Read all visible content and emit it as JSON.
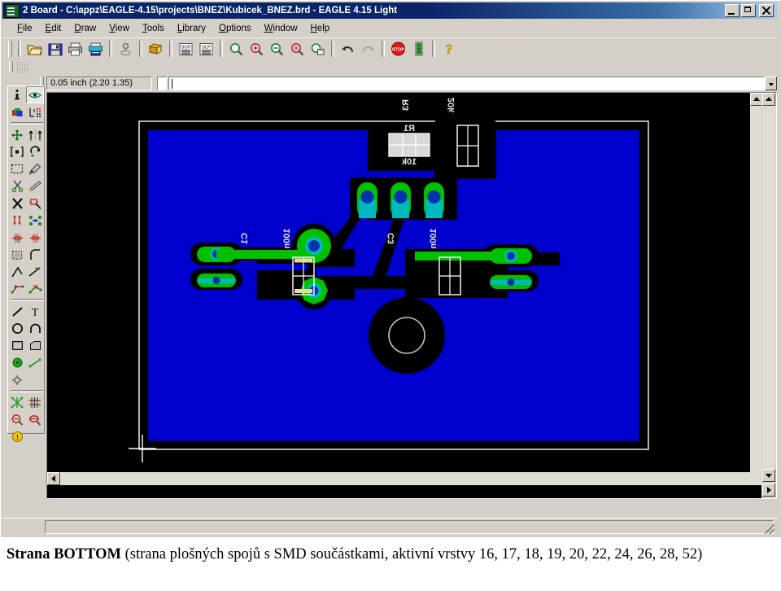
{
  "window": {
    "title": "2 Board - C:\\appz\\EAGLE-4.15\\projects\\BNEZ\\Kubicek_BNEZ.brd - EAGLE 4.15 Light",
    "app_icon": "eagle-board-icon",
    "controls": {
      "minimize": "_",
      "maximize": "□",
      "close": "×"
    }
  },
  "menu": [
    {
      "label": "File",
      "mnemonic": "F"
    },
    {
      "label": "Edit",
      "mnemonic": "E"
    },
    {
      "label": "Draw",
      "mnemonic": "D"
    },
    {
      "label": "View",
      "mnemonic": "V"
    },
    {
      "label": "Tools",
      "mnemonic": "T"
    },
    {
      "label": "Library",
      "mnemonic": "L"
    },
    {
      "label": "Options",
      "mnemonic": "O"
    },
    {
      "label": "Window",
      "mnemonic": "W"
    },
    {
      "label": "Help",
      "mnemonic": "H"
    }
  ],
  "toolbar": {
    "groups": [
      [
        "open-file-icon",
        "save-file-icon",
        "print-icon",
        "print-setup-icon"
      ],
      [
        "cam-processor-icon"
      ],
      [
        "library-icon"
      ],
      [
        "script-icon",
        "ulp-icon"
      ],
      [
        "zoom-fit-icon",
        "zoom-in-icon",
        "zoom-out-icon",
        "zoom-redraw-icon",
        "zoom-select-icon"
      ],
      [
        "undo-icon",
        "redo-icon"
      ],
      [
        "stop-icon",
        "go-icon"
      ],
      [
        "help-icon"
      ]
    ],
    "script_label": "SCR",
    "ulp_label": "ULP",
    "stop_label": "STOP"
  },
  "command_bar": {
    "coordinates": "0.05 inch (2.20 1.35)",
    "command_value": "",
    "command_placeholder": ""
  },
  "palette": {
    "rows": [
      [
        "info-icon",
        "display-layers-icon"
      ],
      [
        "layer-settings-icon",
        "grid-settings-icon"
      ],
      [
        "move-icon",
        "mirror-icon"
      ],
      [
        "group-icon",
        "rotate-icon"
      ],
      [
        "marquee-select-icon",
        "change-icon"
      ],
      [
        "cut-icon",
        "paste-icon"
      ],
      [
        "delete-icon",
        "add-part-icon"
      ],
      [
        "pinswap-icon",
        "replace-icon"
      ],
      [
        "name-icon",
        "value-icon"
      ],
      [
        "smash-icon",
        "miter-icon"
      ],
      [
        "split-icon",
        "optimize-icon"
      ],
      [
        "route-icon",
        "ripup-icon"
      ],
      [
        "wire-icon",
        "text-icon"
      ],
      [
        "circle-icon",
        "arc-icon"
      ],
      [
        "rectangle-icon",
        "polygon-icon"
      ],
      [
        "via-icon",
        "signal-icon"
      ],
      [
        "hole-icon",
        null
      ],
      [
        "ratsnest-icon",
        "drc-icon"
      ],
      [
        "errors-icon",
        "erc-icon"
      ],
      [
        "warning-icon",
        null
      ]
    ],
    "selected": "display-layers-icon"
  },
  "canvas": {
    "background_color": "#000000",
    "board_fill_color": "#0000cc",
    "pad_color": "#00c000",
    "drill_color": "#00b0b0",
    "keepout_color": "#000000",
    "silkscreen_color": "#e8e8e8",
    "board_outline_color": "#ffffff",
    "cursor": "crosshair-cursor",
    "components": [
      {
        "name": "R1",
        "value": "10k",
        "mirrored": true
      },
      {
        "name": "R3",
        "value": "20k",
        "mirrored": true
      },
      {
        "name": "C1",
        "value": "100n",
        "mirrored": true
      },
      {
        "name": "C3",
        "value": "100n",
        "mirrored": true
      }
    ]
  },
  "statusbar": {
    "text": ""
  },
  "caption": {
    "bold_part": "Strana BOTTOM",
    "rest": " (strana plošných spojů s SMD součástkami, aktivní vrstvy 16, 17, 18, 19, 20, 22, 24, 26, 28, 52)"
  }
}
